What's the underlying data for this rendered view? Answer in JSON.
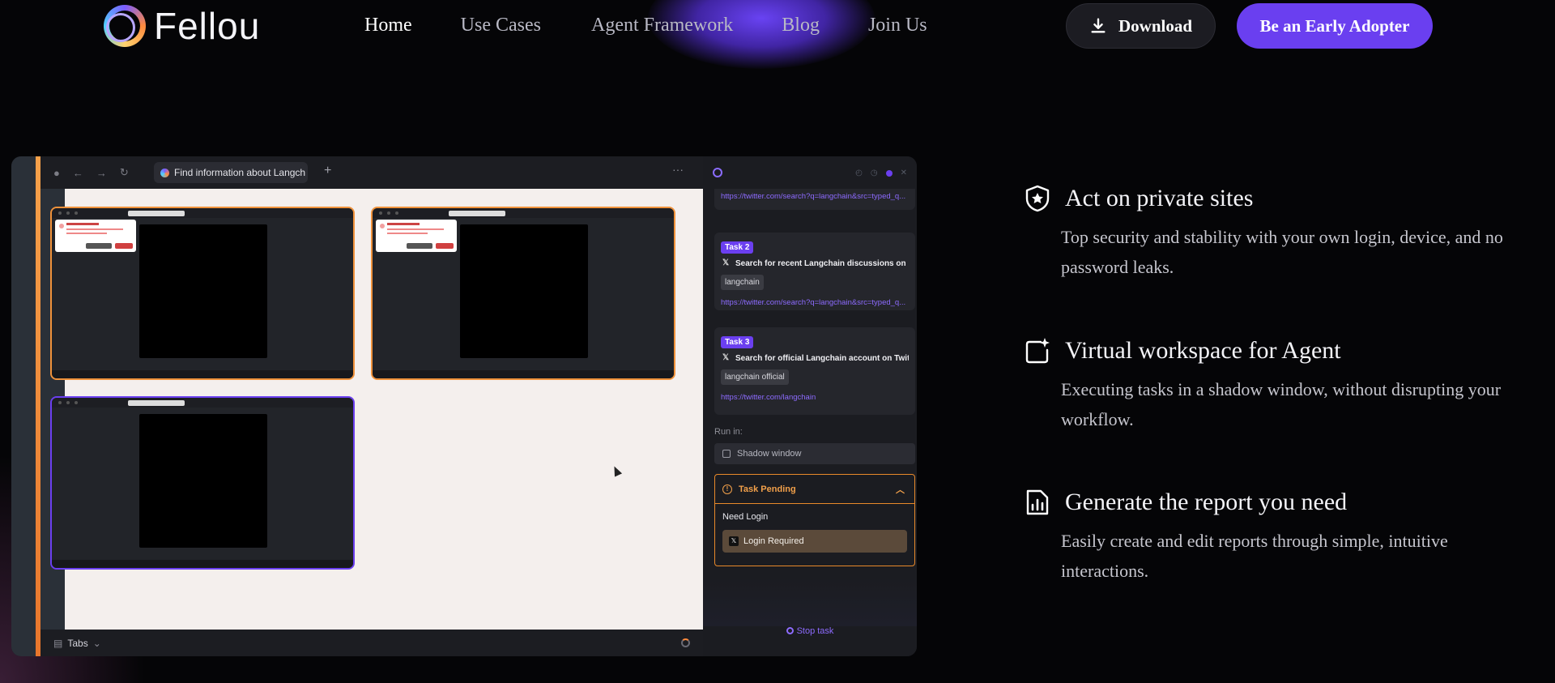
{
  "nav": {
    "brand": "Fellou",
    "links": [
      "Home",
      "Use Cases",
      "Agent Framework",
      "Blog",
      "Join Us"
    ],
    "download_label": "Download",
    "early_label": "Be an Early Adopter",
    "accent_color": "#6a3ff0"
  },
  "app": {
    "tab_title": "Find information about Langch",
    "bottom_tabs_label": "Tabs",
    "tasks": [
      {
        "badge": "",
        "title": "",
        "chip": "",
        "url": "https://twitter.com/search?q=langchain&src=typed_q..."
      },
      {
        "badge": "Task 2",
        "title": "Search for recent Langchain discussions on ...",
        "chip": "langchain",
        "url": "https://twitter.com/search?q=langchain&src=typed_q..."
      },
      {
        "badge": "Task 3",
        "title": "Search for official Langchain account on Twit...",
        "chip": "langchain official",
        "url": "https://twitter.com/langchain"
      }
    ],
    "run_in_label": "Run in:",
    "run_in_value": "Shadow window",
    "pending": {
      "title": "Task Pending",
      "need_login": "Need Login",
      "login_required": "Login Required"
    },
    "stop_task": "Stop task"
  },
  "features": [
    {
      "icon": "shield-star-icon",
      "title": "Act on private sites",
      "desc": "Top security and stability with your own login, device, and no password leaks."
    },
    {
      "icon": "sparkle-window-icon",
      "title": "Virtual workspace for Agent",
      "desc": "Executing tasks in a shadow window, without disrupting your workflow."
    },
    {
      "icon": "report-chart-icon",
      "title": "Generate the report you need",
      "desc": "Easily create and edit reports through simple, intuitive interactions."
    }
  ]
}
